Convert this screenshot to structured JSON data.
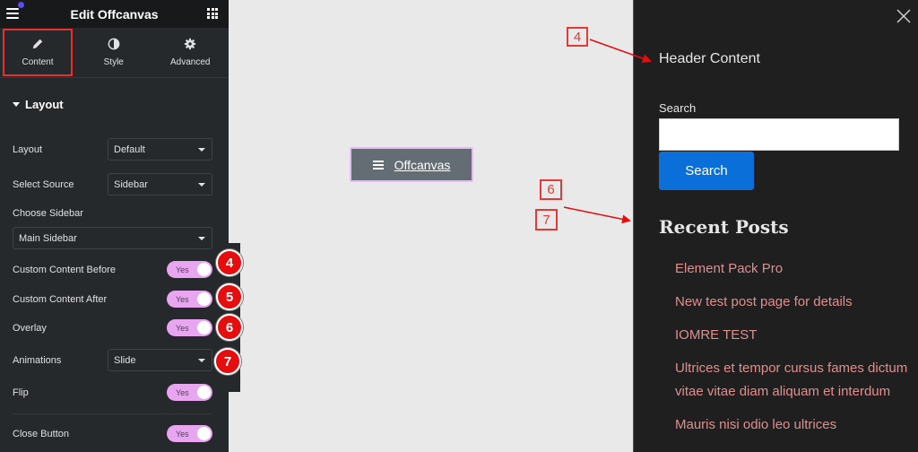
{
  "editor": {
    "title": "Edit Offcanvas",
    "tabs": [
      {
        "label": "Content",
        "icon": "pencil-icon",
        "active": true
      },
      {
        "label": "Style",
        "icon": "half-circle-icon",
        "active": false
      },
      {
        "label": "Advanced",
        "icon": "gear-icon",
        "active": false
      }
    ],
    "section": "Layout",
    "fields": {
      "layout": {
        "label": "Layout",
        "value": "Default"
      },
      "select_source": {
        "label": "Select Source",
        "value": "Sidebar"
      },
      "choose_sidebar": {
        "label": "Choose Sidebar",
        "value": "Main Sidebar"
      },
      "custom_before": {
        "label": "Custom Content Before",
        "value": "Yes"
      },
      "custom_after": {
        "label": "Custom Content After",
        "value": "Yes"
      },
      "overlay": {
        "label": "Overlay",
        "value": "Yes"
      },
      "animations": {
        "label": "Animations",
        "value": "Slide"
      },
      "flip": {
        "label": "Flip",
        "value": "Yes"
      },
      "close_button": {
        "label": "Close Button",
        "value": "Yes"
      }
    }
  },
  "badges": [
    "4",
    "5",
    "6",
    "7"
  ],
  "callouts": [
    "4",
    "6",
    "7"
  ],
  "canvas": {
    "button_label": "Offcanvas"
  },
  "offcanvas": {
    "header_content": "Header Content",
    "search_label": "Search",
    "search_value": "",
    "search_button": "Search",
    "recent_posts_title": "Recent Posts",
    "posts": [
      "Element Pack Pro",
      "New test post page for details",
      "IOMRE TEST",
      "Ultrices et tempor cursus fames dictum vitae vitae diam aliquam et interdum",
      "Mauris nisi odio leo ultrices"
    ]
  },
  "colors": {
    "accent_toggle": "#e8a6f1",
    "badge_red": "#e50d0d",
    "search_button": "#0a6fd8",
    "post_link": "#e08f8f"
  }
}
